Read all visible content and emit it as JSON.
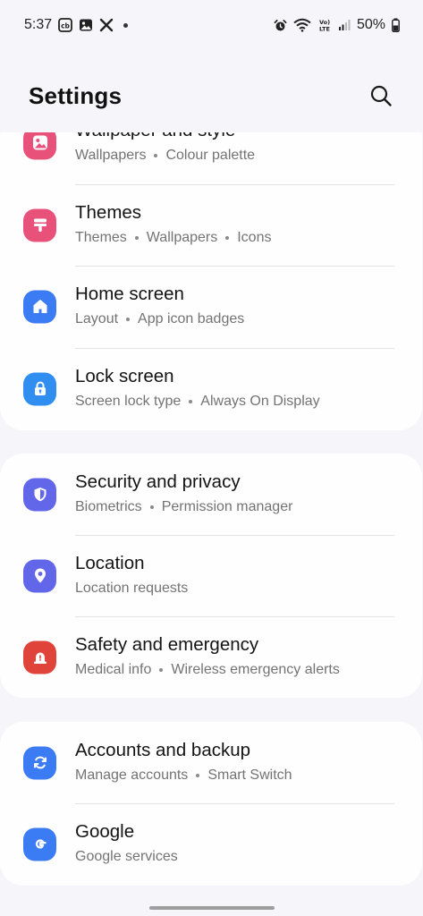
{
  "status_bar": {
    "time": "5:37",
    "battery": "50%",
    "notification_icons": [
      "cb-icon",
      "gallery-icon",
      "x-icon"
    ],
    "status_icons": [
      "alarm-icon",
      "wifi-icon",
      "volte-icon",
      "signal-icon",
      "battery-icon"
    ]
  },
  "header": {
    "title": "Settings"
  },
  "groups": [
    {
      "items": [
        {
          "title": "Wallpaper and style",
          "subtitle": [
            "Wallpapers",
            "Colour palette"
          ],
          "icon": "wallpaper-icon",
          "color": "#e8517a"
        },
        {
          "title": "Themes",
          "subtitle": [
            "Themes",
            "Wallpapers",
            "Icons"
          ],
          "icon": "themes-icon",
          "color": "#e8517a"
        },
        {
          "title": "Home screen",
          "subtitle": [
            "Layout",
            "App icon badges"
          ],
          "icon": "home-icon",
          "color": "#3b7cf4"
        },
        {
          "title": "Lock screen",
          "subtitle": [
            "Screen lock type",
            "Always On Display"
          ],
          "icon": "lock-icon",
          "color": "#2f8ef0"
        }
      ]
    },
    {
      "items": [
        {
          "title": "Security and privacy",
          "subtitle": [
            "Biometrics",
            "Permission manager"
          ],
          "icon": "shield-icon",
          "color": "#6267ea"
        },
        {
          "title": "Location",
          "subtitle": [
            "Location requests"
          ],
          "icon": "location-pin-icon",
          "color": "#6267ea"
        },
        {
          "title": "Safety and emergency",
          "subtitle": [
            "Medical info",
            "Wireless emergency alerts"
          ],
          "icon": "emergency-icon",
          "color": "#e0433a"
        }
      ]
    },
    {
      "items": [
        {
          "title": "Accounts and backup",
          "subtitle": [
            "Manage accounts",
            "Smart Switch"
          ],
          "icon": "sync-icon",
          "color": "#3b7cf4"
        },
        {
          "title": "Google",
          "subtitle": [
            "Google services"
          ],
          "icon": "google-icon",
          "color": "#3b7cf4"
        }
      ]
    }
  ]
}
